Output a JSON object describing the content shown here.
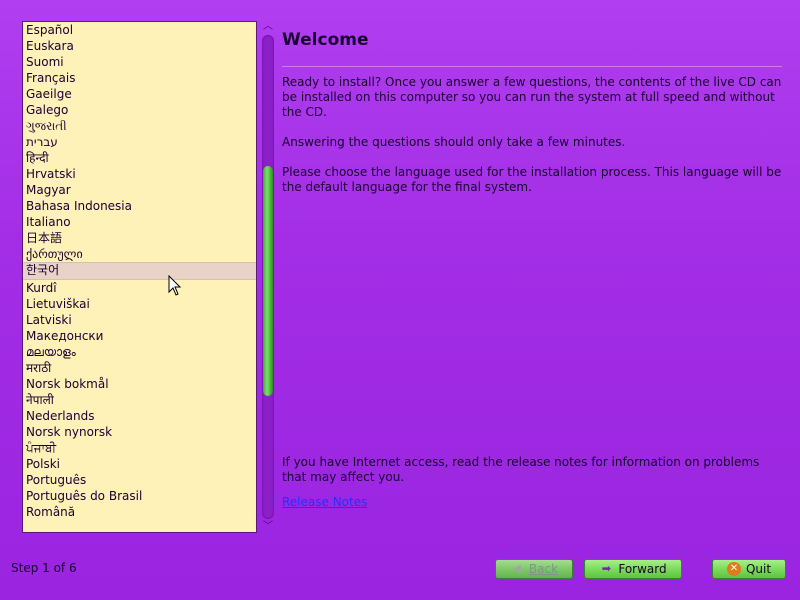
{
  "languages": [
    "Español",
    "Euskara",
    "Suomi",
    "Français",
    "Gaeilge",
    "Galego",
    "ગુજરાતી",
    "עברית",
    "हिन्दी",
    "Hrvatski",
    "Magyar",
    "Bahasa Indonesia",
    "Italiano",
    "日本語",
    "ქართული",
    "한국어",
    "Kurdî",
    "Lietuviškai",
    "Latviski",
    "Македонски",
    "മലയാളം",
    "मराठी",
    "Norsk bokmål",
    "नेपाली",
    "Nederlands",
    "Norsk nynorsk",
    "ਪੰਜਾਬੀ",
    "Polski",
    "Português",
    "Português do Brasil",
    "Română"
  ],
  "selected_language": "한국어",
  "main": {
    "title": "Welcome",
    "intro": "Ready to install? Once you answer a few questions, the contents of the live CD can be installed on this computer so you can run the system at full speed and without the CD.",
    "time_note": "Answering the questions should only take a few minutes.",
    "choose_note": "Please choose the language used for the installation process. This language will be the default language for the final system.",
    "release_info": "If you have Internet access, read the release notes for information on problems that may affect you.",
    "release_link": "Release Notes"
  },
  "footer": {
    "step": "Step 1 of 6",
    "back_label": "Back",
    "forward_label": "Forward",
    "quit_label": "Quit"
  },
  "colors": {
    "background": "#a32ee6",
    "list_background": "#fff2b8",
    "button_green": "#7cdb5c",
    "link": "#2030ff"
  },
  "icons": {
    "back": "arrow-left-icon",
    "forward": "arrow-right-icon",
    "quit": "quit-icon"
  }
}
